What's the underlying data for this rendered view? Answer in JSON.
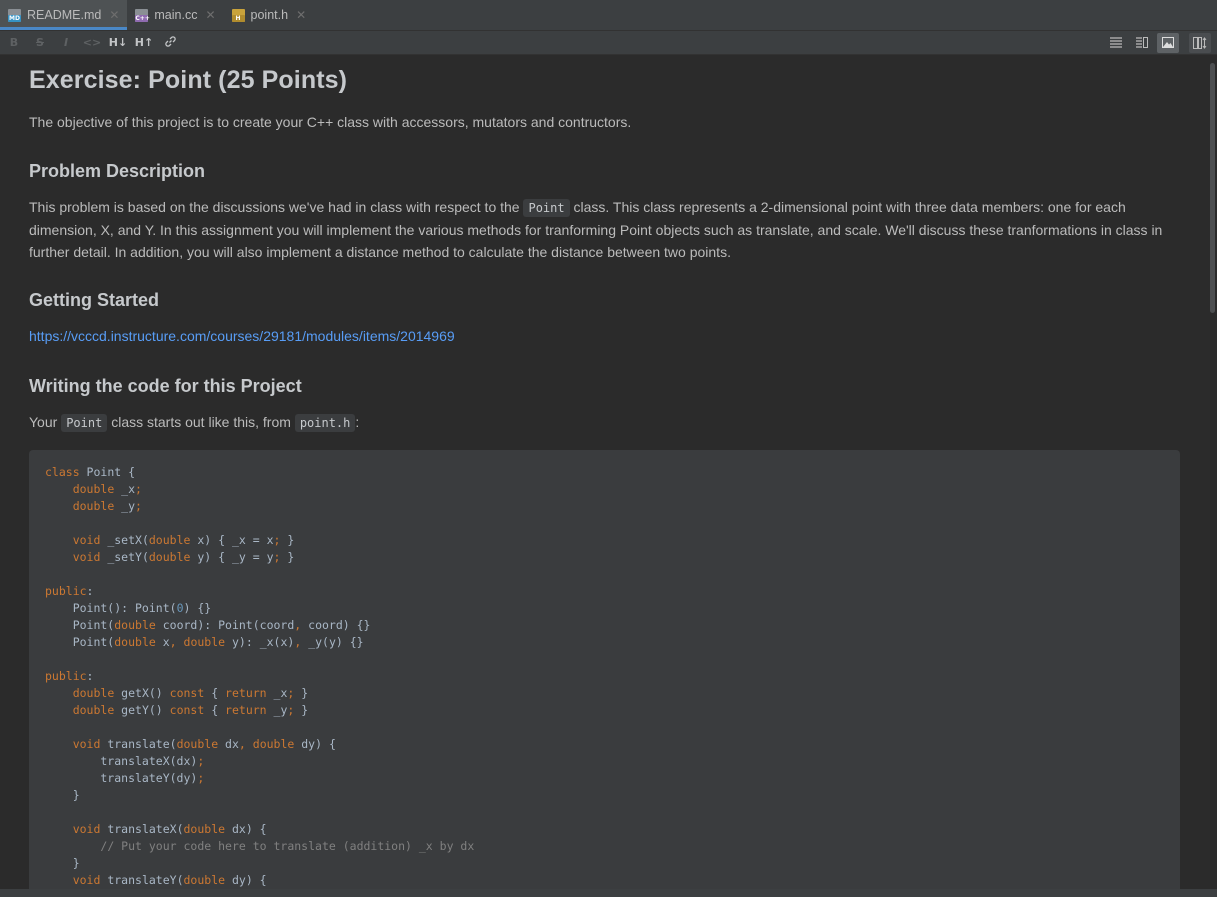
{
  "tabs": [
    {
      "label": "README.md",
      "icon": "markdown-file-icon",
      "active": true
    },
    {
      "label": "main.cc",
      "icon": "cpp-file-icon",
      "active": false
    },
    {
      "label": "point.h",
      "icon": "header-file-icon",
      "active": false
    }
  ],
  "toolbar": {
    "bold": "B",
    "strike": "S",
    "italic": "I",
    "code": "<>",
    "header_down": "H↓",
    "header_up": "H↑"
  },
  "doc": {
    "title": "Exercise: Point (25 Points)",
    "intro": "The objective of this project is to create your C++ class with accessors, mutators and contructors.",
    "h_problem": "Problem Description",
    "problem_pre": "This problem is based on the discussions we've had in class with respect to the",
    "problem_code": "Point",
    "problem_post": "class. This class represents a 2-dimensional point with three data members: one for each dimension, X, and Y. In this assignment you will implement the various methods for tranforming Point objects such as translate, and scale. We'll discuss these tranformations in class in further detail. In addition, you will also implement a distance method to calculate the distance between two points.",
    "h_started": "Getting Started",
    "link": "https://vcccd.instructure.com/courses/29181/modules/items/2014969",
    "h_writing": "Writing the code for this Project",
    "your_pre": "Your",
    "your_code1": "Point",
    "your_mid": "class starts out like this, from",
    "your_code2": "point.h",
    "your_post": ":"
  },
  "code_lines": [
    "class Point {",
    "    double _x;",
    "    double _y;",
    "",
    "    void _setX(double x) { _x = x; }",
    "    void _setY(double y) { _y = y; }",
    "",
    "public:",
    "    Point(): Point(0) {}",
    "    Point(double coord): Point(coord, coord) {}",
    "    Point(double x, double y): _x(x), _y(y) {}",
    "",
    "public:",
    "    double getX() const { return _x; }",
    "    double getY() const { return _y; }",
    "",
    "    void translate(double dx, double dy) {",
    "        translateX(dx);",
    "        translateY(dy);",
    "    }",
    "",
    "    void translateX(double dx) {",
    "        // Put your code here to translate (addition) _x by dx",
    "    }",
    "    void translateY(double dy) {"
  ]
}
